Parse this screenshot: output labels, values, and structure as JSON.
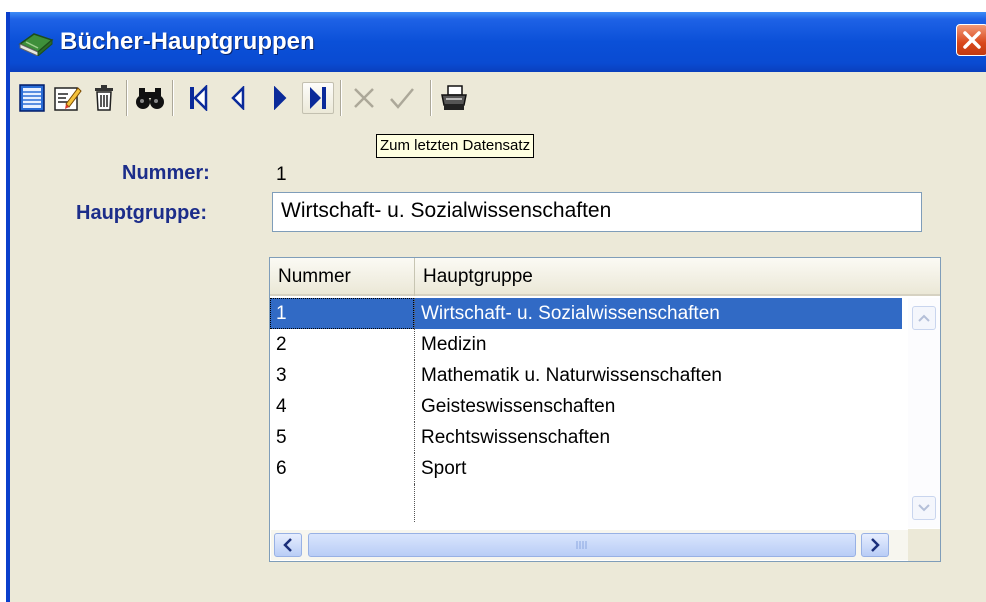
{
  "window": {
    "title": "Bücher-Hauptgruppen"
  },
  "toolbar": {
    "buttons": [
      {
        "icon": "new-record-icon"
      },
      {
        "icon": "edit-record-icon"
      },
      {
        "icon": "delete-icon"
      },
      {
        "icon": "binoculars-icon"
      },
      {
        "icon": "first-record-icon"
      },
      {
        "icon": "previous-record-icon"
      },
      {
        "icon": "next-record-icon"
      },
      {
        "icon": "last-record-icon"
      },
      {
        "icon": "cancel-icon"
      },
      {
        "icon": "confirm-icon"
      },
      {
        "icon": "print-icon"
      }
    ],
    "tooltip": "Zum letzten Datensatz"
  },
  "form": {
    "nummer_label": "Nummer:",
    "nummer_value": "1",
    "hauptgruppe_label": "Hauptgruppe:",
    "hauptgruppe_value": "Wirtschaft- u. Sozialwissenschaften"
  },
  "grid": {
    "columns": [
      "Nummer",
      "Hauptgruppe"
    ],
    "rows": [
      {
        "nummer": "1",
        "hauptgruppe": "Wirtschaft- u. Sozialwissenschaften",
        "selected": true
      },
      {
        "nummer": "2",
        "hauptgruppe": "Medizin"
      },
      {
        "nummer": "3",
        "hauptgruppe": "Mathematik u. Naturwissenschaften"
      },
      {
        "nummer": "4",
        "hauptgruppe": "Geisteswissenschaften"
      },
      {
        "nummer": "5",
        "hauptgruppe": "Rechtswissenschaften"
      },
      {
        "nummer": "6",
        "hauptgruppe": "Sport"
      }
    ]
  },
  "colors": {
    "title_bar": "#0b50d8",
    "label_text": "#1c2d8a",
    "selection": "#316ac5",
    "window_bg": "#ece9d8"
  }
}
